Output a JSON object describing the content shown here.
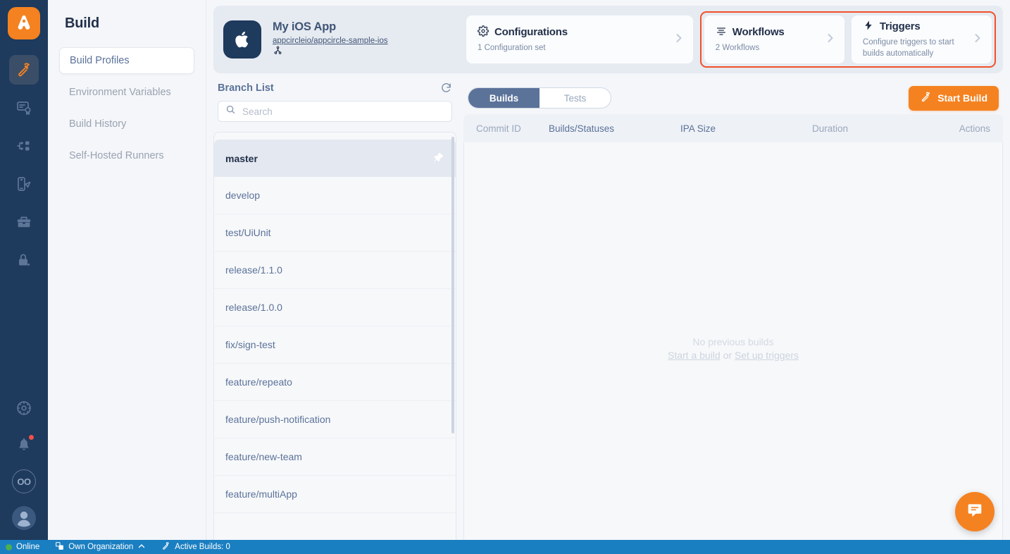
{
  "rail": {
    "logo_name": "appcircle-logo",
    "items": [
      {
        "name": "build",
        "icon": "hammer-icon",
        "active": true
      },
      {
        "name": "signing-identities",
        "icon": "certificate-icon",
        "active": false
      },
      {
        "name": "distribution",
        "icon": "distribution-flow-icon",
        "active": false
      },
      {
        "name": "testing-distribution",
        "icon": "device-send-icon",
        "active": false
      },
      {
        "name": "store-submit",
        "icon": "briefcase-icon",
        "active": false
      },
      {
        "name": "login-security",
        "icon": "lock-user-icon",
        "active": false
      }
    ],
    "bottom": [
      {
        "name": "settings",
        "icon": "gear-icon"
      },
      {
        "name": "notifications",
        "icon": "bell-icon",
        "badge": true
      },
      {
        "name": "organization-avatar",
        "icon": "oo-avatar",
        "label": "OO"
      },
      {
        "name": "user-avatar",
        "icon": "user-icon"
      }
    ]
  },
  "subnav": {
    "title": "Build",
    "items": [
      {
        "label": "Build Profiles",
        "active": true
      },
      {
        "label": "Environment Variables",
        "active": false
      },
      {
        "label": "Build History",
        "active": false
      },
      {
        "label": "Self-Hosted Runners",
        "active": false
      }
    ]
  },
  "header": {
    "app_name": "My iOS App",
    "repo": "appcircleio/appcircle-sample-ios",
    "platform_icon": "apple-icon",
    "git_icon": "git-branch-icon",
    "cards": [
      {
        "title": "Configurations",
        "subtitle": "1 Configuration set",
        "icon": "gear-icon",
        "highlighted": false
      },
      {
        "title": "Workflows",
        "subtitle": "2 Workflows",
        "icon": "workflow-icon",
        "highlighted": true
      },
      {
        "title": "Triggers",
        "subtitle": "Configure triggers to start builds automatically",
        "icon": "lightning-icon",
        "highlighted": true
      }
    ],
    "highlight_color": "#f2502a"
  },
  "branches": {
    "title": "Branch List",
    "refresh_icon": "refresh-icon",
    "search_placeholder": "Search",
    "search_value": "",
    "search_icon": "search-icon",
    "items": [
      {
        "name": "master",
        "selected": true,
        "pinned": true
      },
      {
        "name": "develop",
        "selected": false,
        "pinned": false
      },
      {
        "name": "test/UiUnit",
        "selected": false,
        "pinned": false
      },
      {
        "name": "release/1.1.0",
        "selected": false,
        "pinned": false
      },
      {
        "name": "release/1.0.0",
        "selected": false,
        "pinned": false
      },
      {
        "name": "fix/sign-test",
        "selected": false,
        "pinned": false
      },
      {
        "name": "feature/repeato",
        "selected": false,
        "pinned": false
      },
      {
        "name": "feature/push-notification",
        "selected": false,
        "pinned": false
      },
      {
        "name": "feature/new-team",
        "selected": false,
        "pinned": false
      },
      {
        "name": "feature/multiApp",
        "selected": false,
        "pinned": false
      }
    ]
  },
  "builds": {
    "tabs": [
      {
        "label": "Builds",
        "active": true
      },
      {
        "label": "Tests",
        "active": false
      }
    ],
    "start_build_label": "Start Build",
    "start_build_icon": "hammer-icon",
    "accent_color": "#f58220",
    "columns": [
      {
        "label": "Commit ID",
        "emphasis": false
      },
      {
        "label": "Builds/Statuses",
        "emphasis": true
      },
      {
        "label": "IPA Size",
        "emphasis": true
      },
      {
        "label": "Duration",
        "emphasis": false
      },
      {
        "label": "Actions",
        "emphasis": false
      }
    ],
    "empty": {
      "title": "No previous builds",
      "link_start": "Start a build",
      "separator": " or ",
      "link_triggers": "Set up triggers"
    }
  },
  "fab": {
    "icon": "chat-icon"
  },
  "statusbar": {
    "online_label": "Online",
    "organization_label": "Own Organization",
    "organization_chevron": "chevron-up-icon",
    "active_builds_label": "Active Builds: 0",
    "org_icon": "organization-icon",
    "build_icon": "hammer-icon",
    "background": "#1a7fc1"
  }
}
